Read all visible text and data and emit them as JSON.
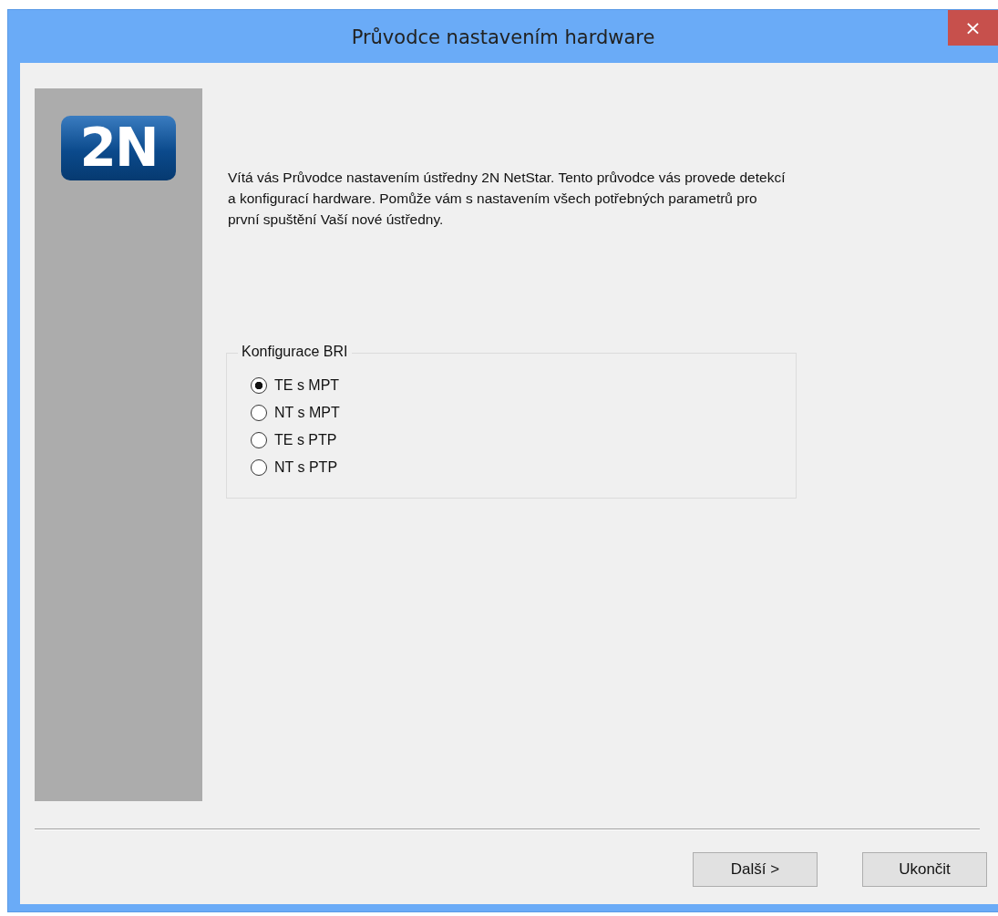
{
  "window": {
    "title": "Průvodce nastavením hardware",
    "close": "×"
  },
  "logo": {
    "text": "2N"
  },
  "intro": "Vítá vás Průvodce nastavením ústředny 2N NetStar. Tento průvodce vás provede detekcí a konfigurací hardware. Pomůže vám s nastavením všech potřebných parametrů pro první spuštění Vaší nové ústředny.",
  "group": {
    "title": "Konfigurace BRI",
    "options": [
      {
        "label": "TE s MPT",
        "selected": true
      },
      {
        "label": "NT s MPT",
        "selected": false
      },
      {
        "label": "TE s PTP",
        "selected": false
      },
      {
        "label": "NT s PTP",
        "selected": false
      }
    ]
  },
  "buttons": [
    {
      "label": "Další >"
    },
    {
      "label": "Ukončit"
    }
  ]
}
